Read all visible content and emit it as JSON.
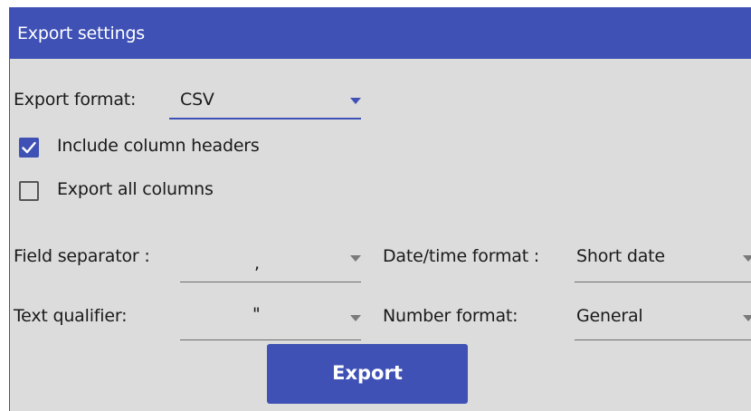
{
  "dialog": {
    "title": "Export settings"
  },
  "export_format": {
    "label": "Export format:",
    "value": "CSV"
  },
  "options": {
    "include_headers": {
      "label": "Include column headers",
      "checked": true
    },
    "export_all_columns": {
      "label": "Export all columns",
      "checked": false
    }
  },
  "field_separator": {
    "label": "Field separator :",
    "value": ","
  },
  "text_qualifier": {
    "label": "Text qualifier:",
    "value": "\""
  },
  "datetime_format": {
    "label": "Date/time format :",
    "value": "Short date"
  },
  "number_format": {
    "label": "Number format:",
    "value": "General"
  },
  "actions": {
    "export_label": "Export"
  },
  "colors": {
    "accent": "#3f51b5",
    "panel_background": "#dcdcdc",
    "title_text": "#ffffff"
  },
  "icons": {
    "dropdown": "triangle-down",
    "checkbox_checked": "checkmark"
  }
}
